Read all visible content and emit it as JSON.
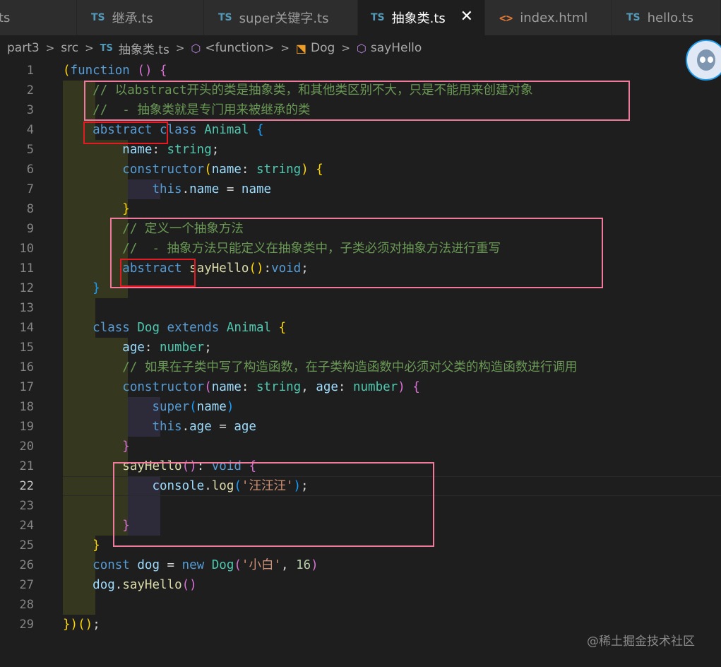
{
  "tabs": [
    {
      "icon": "TS",
      "label": "ts"
    },
    {
      "icon": "TS",
      "label": "继承.ts"
    },
    {
      "icon": "TS",
      "label": "super关键字.ts"
    },
    {
      "icon": "TS",
      "label": "抽象类.ts",
      "active": true,
      "close": "✕"
    },
    {
      "icon": "<>",
      "label": "index.html"
    },
    {
      "icon": "TS",
      "label": "hello.ts"
    }
  ],
  "breadcrumb": {
    "items": [
      "part3",
      "src",
      "抽象类.ts",
      "<function>",
      "Dog",
      "sayHello"
    ],
    "ts_icon": "TS",
    "separator": ">"
  },
  "editor": {
    "line_numbers": [
      "1",
      "2",
      "3",
      "4",
      "5",
      "6",
      "7",
      "8",
      "9",
      "10",
      "11",
      "12",
      "13",
      "14",
      "15",
      "16",
      "17",
      "18",
      "19",
      "20",
      "21",
      "22",
      "23",
      "24",
      "25",
      "26",
      "27",
      "28",
      "29"
    ],
    "current_line": 22,
    "t": {
      "function": "function",
      "lp": "(",
      "rp": ")",
      "lb": "{",
      "rb": "}",
      "c2": "// 以abstract开头的类是抽象类，和其他类区别不大，只是不能用来创建对象",
      "c3": "//  - 抽象类就是专门用来被继承的类",
      "abstract": "abstract",
      "class": "class",
      "Animal": "Animal",
      "name": "name",
      "colon": ": ",
      "colon_nosp": ":",
      "string": "string",
      "semi": ";",
      "constructor": "constructor",
      "this": "this",
      "dot": ".",
      "eq": " = ",
      "c9": "// 定义一个抽象方法",
      "c10": "//  - 抽象方法只能定义在抽象类中，子类必须对抽象方法进行重写",
      "sayHello": "sayHello",
      "void": "void",
      "Dog": "Dog",
      "extends": "extends",
      "age": "age",
      "number": "number",
      "c16": "// 如果在子类中写了构造函数，在子类构造函数中必须对父类的构造函数进行调用",
      "comma": ", ",
      "super": "super",
      "console": "console",
      "log": "log",
      "str_wang": "'汪汪汪'",
      "const": "const",
      "dog": "dog",
      "new": "new",
      "str_xiaobai": "'小白'",
      "num16": "16",
      "end": "})();",
      "sp": " "
    }
  },
  "watermark": "@稀土掘金技术社区"
}
